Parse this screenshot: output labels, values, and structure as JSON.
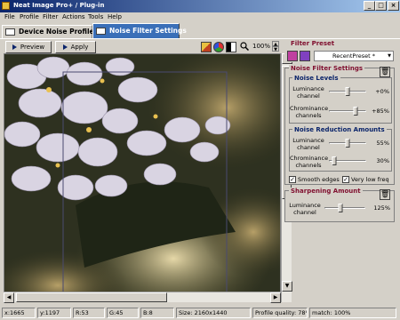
{
  "window": {
    "title": "Neat Image Pro+ / Plug-in"
  },
  "menu": [
    "File",
    "Profile",
    "Filter",
    "Actions",
    "Tools",
    "Help"
  ],
  "tabs": [
    {
      "label": "Device Noise Profile",
      "active": false
    },
    {
      "label": "Noise Filter Settings",
      "active": true
    }
  ],
  "toolbar": {
    "preview_label": "Preview",
    "apply_label": "Apply",
    "zoom": "100%"
  },
  "filter_preset": {
    "title": "Filter Preset",
    "selected": "RecentPreset *"
  },
  "noise_filter_settings": {
    "title": "Noise Filter Settings",
    "noise_levels": {
      "title": "Noise Levels",
      "luminance": {
        "label": "Luminance channel",
        "value": "+0%",
        "level": 0.5
      },
      "chrominance": {
        "label": "Chrominance channels",
        "value": "+85%",
        "level": 0.72
      }
    },
    "noise_reduction": {
      "title": "Noise Reduction Amounts",
      "luminance": {
        "label": "Luminance channel",
        "value": "55%",
        "level": 0.5
      },
      "chrominance": {
        "label": "Chrominance channels",
        "value": "30%",
        "level": 0.15
      }
    },
    "smooth_edges": {
      "label": "Smooth edges",
      "checked": true
    },
    "very_low_freq": {
      "label": "Very low freq",
      "checked": true
    }
  },
  "sharpening": {
    "title": "Sharpening Amount",
    "luminance": {
      "label": "Luminance channel",
      "value": "125%",
      "level": 0.4
    }
  },
  "status": {
    "x": "x:1665",
    "y": "y:1197",
    "r": "R:53",
    "g": "G:45",
    "b": "B:8",
    "size": "Size: 2160x1440",
    "profile_quality": "Profile quality: 78%",
    "match": "match: 100%"
  },
  "colors": {
    "title_start": "#0a246a",
    "title_end": "#a6caf0",
    "active_tab": "#3a6fb8",
    "group_title": "#801030",
    "subgroup_title": "#0a246a"
  }
}
